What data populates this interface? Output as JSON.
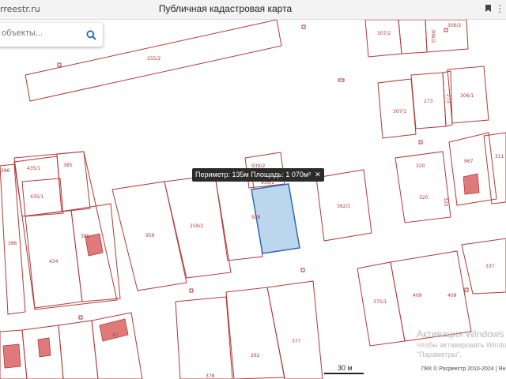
{
  "header": {
    "url": "rreestr.ru",
    "title": "Публичная кадастровая карта"
  },
  "search": {
    "placeholder": "объекты..."
  },
  "tooltip": {
    "text": "Периметр: 135м Площадь: 1 070м²"
  },
  "scale": {
    "label": "30 м"
  },
  "copyright": "ПКК © Росреестр 2010-2024 | Ян",
  "watermark": {
    "line1": "Активация Windows",
    "line2": "Чтобы активировать Windows",
    "line3": "\"Параметры\"."
  },
  "parcels": [
    "255/2",
    "307/2",
    "306/2",
    "306/2",
    "307/1",
    "273",
    "273",
    "306/1",
    "967",
    "320",
    "320",
    "320",
    "311",
    "386",
    "435/1",
    "385",
    "435/1",
    "386",
    "434",
    "385",
    "959",
    "259/2",
    "939/2",
    "939/2",
    "938",
    "362/1",
    "375/1",
    "409",
    "409",
    "337",
    "292",
    "377",
    "378",
    "47"
  ],
  "colors": {
    "accent": "#2d6ab3",
    "boundary": "#b03a3a",
    "highlight": "#bcd6ee",
    "building": "#e07a7a"
  },
  "icons": {
    "search": "search-icon",
    "bookmark": "bookmark-icon",
    "menu": "menu-icon",
    "close": "close-icon"
  }
}
